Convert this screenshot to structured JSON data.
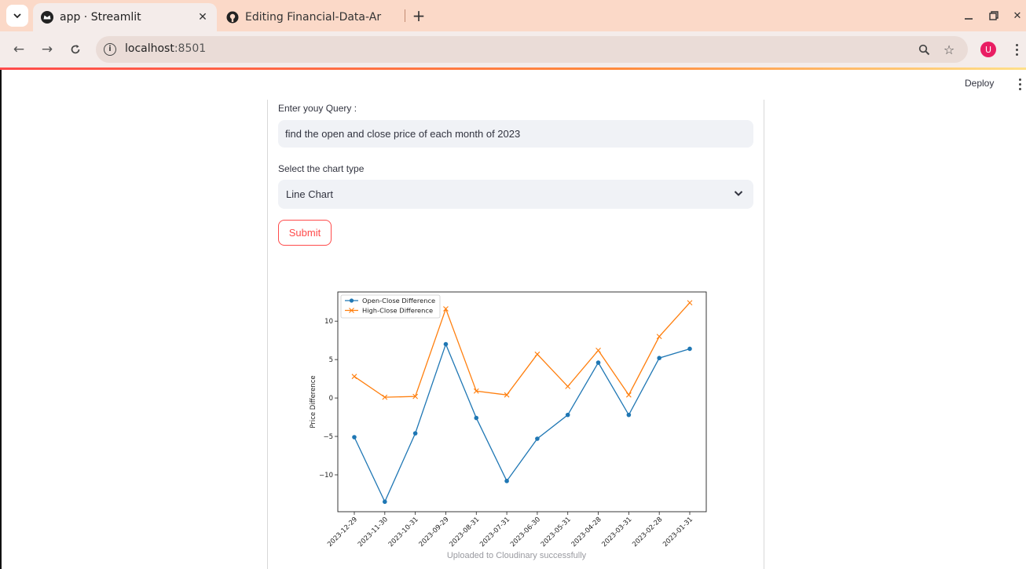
{
  "browser": {
    "tabs": [
      {
        "title": "app · Streamlit",
        "icon": "streamlit-crown-icon",
        "active": true
      },
      {
        "title": "Editing Financial-Data-Ar",
        "icon": "github-icon",
        "active": false
      }
    ],
    "url": {
      "host": "localhost",
      "port": ":8501"
    },
    "profile_initial": "U"
  },
  "streamlit": {
    "deploy_label": "Deploy",
    "query_label": "Enter youy Query :",
    "query_value": "find the open and close price of each month of 2023",
    "chart_type_label": "Select the chart type",
    "chart_type_value": "Line Chart",
    "submit_label": "Submit",
    "caption": "Uploaded to Cloudinary successfully"
  },
  "colors": {
    "accent": "#ff4b4b",
    "series1": "#1f77b4",
    "series2": "#ff7f0e"
  },
  "chart_data": {
    "type": "line",
    "ylabel": "Price Difference",
    "xlabel": "",
    "ylim": [
      -14.8,
      13.8
    ],
    "yticks": [
      -10,
      -5,
      0,
      5,
      10
    ],
    "legend_position": "top-left",
    "categories": [
      "2023-12-29",
      "2023-11-30",
      "2023-10-31",
      "2023-09-29",
      "2023-08-31",
      "2023-07-31",
      "2023-06-30",
      "2023-05-31",
      "2023-04-28",
      "2023-03-31",
      "2023-02-28",
      "2023-01-31"
    ],
    "series": [
      {
        "name": "Open-Close Difference",
        "marker": "o",
        "color": "#1f77b4",
        "values": [
          -5.1,
          -13.5,
          -4.6,
          7.0,
          -2.6,
          -10.8,
          -5.3,
          -2.2,
          4.6,
          -2.2,
          5.2,
          6.4
        ]
      },
      {
        "name": "High-Close Difference",
        "marker": "x",
        "color": "#ff7f0e",
        "values": [
          2.8,
          0.1,
          0.2,
          11.6,
          0.9,
          0.4,
          5.7,
          1.5,
          6.2,
          0.4,
          8.0,
          12.4
        ]
      }
    ]
  }
}
